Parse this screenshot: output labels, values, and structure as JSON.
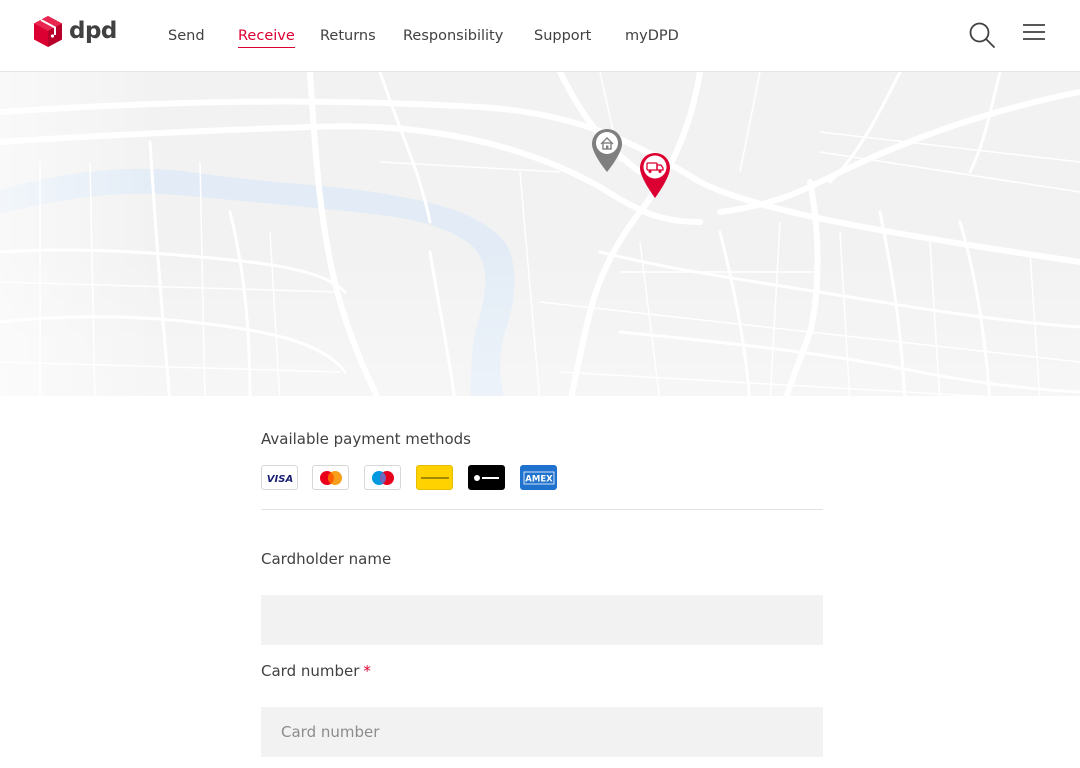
{
  "brand": {
    "name": "dpd",
    "accent": "#dc0032",
    "text_color": "#414042"
  },
  "nav": {
    "items": [
      {
        "label": "Send",
        "active": false
      },
      {
        "label": "Receive",
        "active": true
      },
      {
        "label": "Returns",
        "active": false
      },
      {
        "label": "Responsibility",
        "active": false
      },
      {
        "label": "Support",
        "active": false
      },
      {
        "label": "myDPD",
        "active": false
      }
    ],
    "search_icon": "search-icon",
    "menu_icon": "hamburger-menu-icon"
  },
  "map": {
    "pins": [
      {
        "icon": "home-pin-icon",
        "color": "#808080"
      },
      {
        "icon": "delivery-van-pin-icon",
        "color": "#dc0032"
      }
    ]
  },
  "payment": {
    "title": "Available payment methods",
    "methods": [
      {
        "name": "VISA",
        "icon": "visa-icon"
      },
      {
        "name": "Mastercard",
        "icon": "mastercard-icon"
      },
      {
        "name": "Maestro",
        "icon": "maestro-icon"
      },
      {
        "name": "Payconiq",
        "icon": "payconiq-icon"
      },
      {
        "name": "TWINT",
        "icon": "twint-icon"
      },
      {
        "name": "AMEX",
        "icon": "amex-icon"
      }
    ]
  },
  "form": {
    "cardholder": {
      "label": "Cardholder name",
      "value": "",
      "placeholder": ""
    },
    "card_number": {
      "label": "Card number",
      "required_mark": "*",
      "value": "",
      "placeholder": "Card number"
    }
  }
}
